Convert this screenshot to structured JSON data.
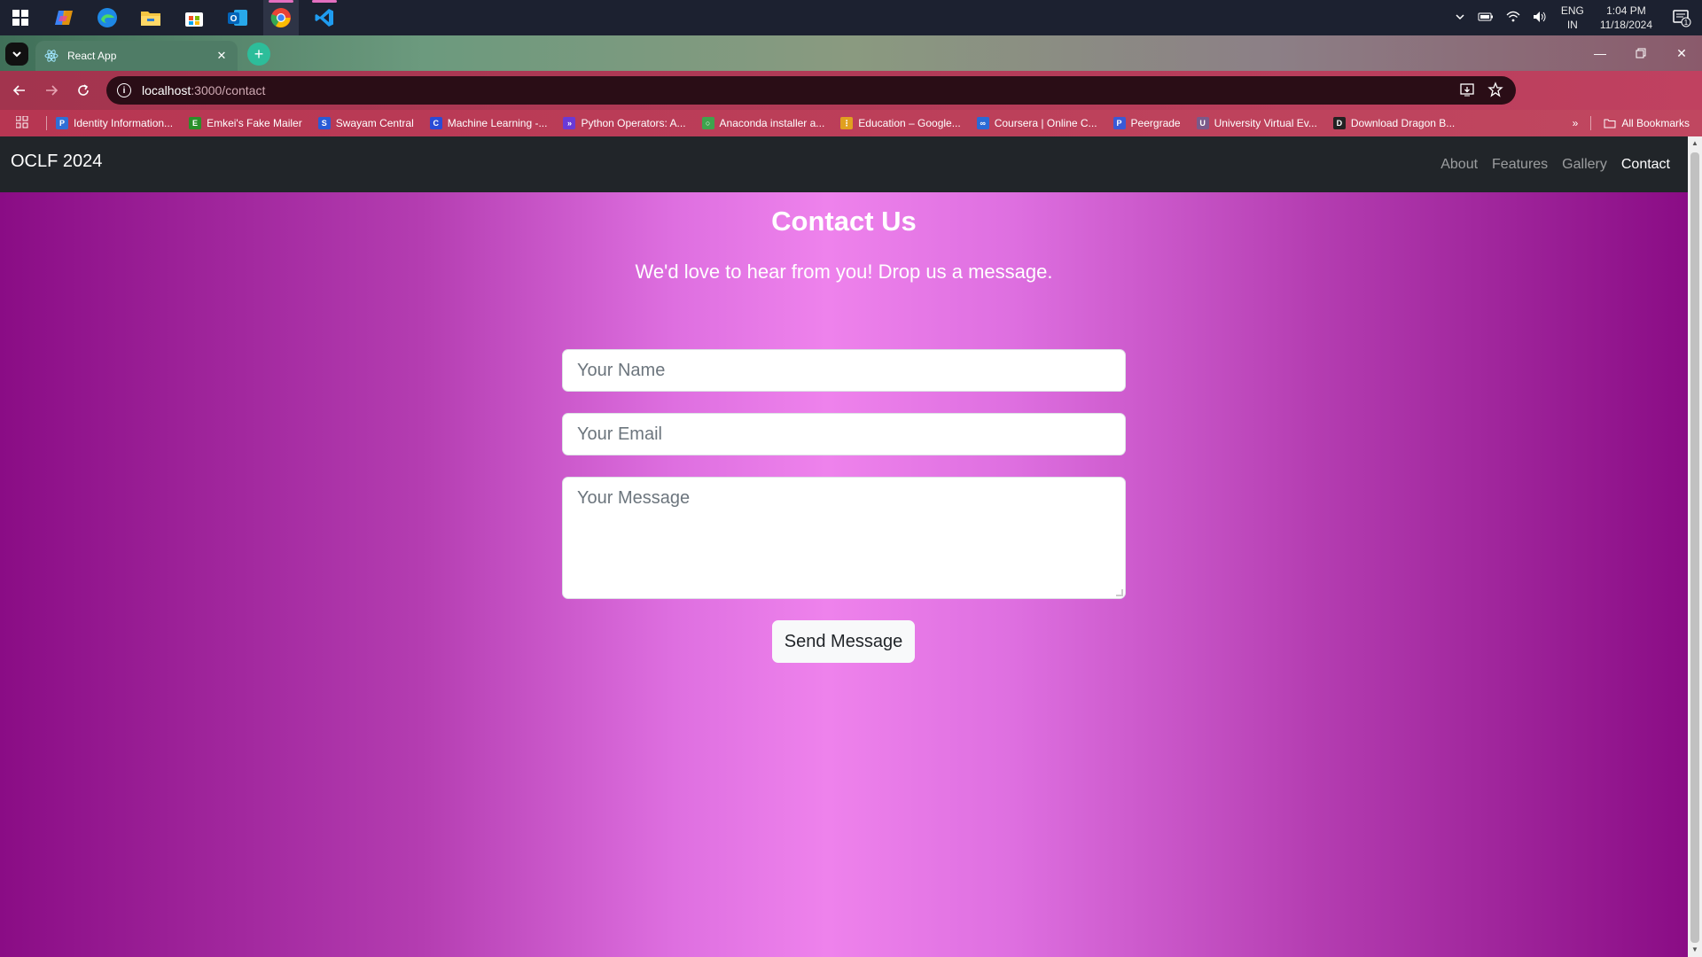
{
  "taskbar": {
    "apps": [
      "windows-start-icon",
      "copilot-icon",
      "edge-icon",
      "file-explorer-icon",
      "microsoft-store-icon",
      "outlook-icon",
      "chrome-icon",
      "vscode-icon"
    ],
    "language_line1": "ENG",
    "language_line2": "IN",
    "time": "1:04 PM",
    "date": "11/18/2024",
    "notification_count": "1"
  },
  "browser": {
    "tab_title": "React App",
    "url_host": "localhost",
    "url_path": ":3000/contact",
    "bookmarks": [
      {
        "label": "Identity Information...",
        "color": "#2f6fd6",
        "glyph": "P"
      },
      {
        "label": "Emkei's Fake Mailer",
        "color": "#2a8f2a",
        "glyph": "E"
      },
      {
        "label": "Swayam Central",
        "color": "#2a5bd6",
        "glyph": "S"
      },
      {
        "label": "Machine Learning -...",
        "color": "#2a4bd6",
        "glyph": "C"
      },
      {
        "label": "Python Operators: A...",
        "color": "#6a3ad6",
        "glyph": "»"
      },
      {
        "label": "Anaconda installer a...",
        "color": "#3fa34d",
        "glyph": "○"
      },
      {
        "label": "Education – Google...",
        "color": "#e0a020",
        "glyph": "⋮"
      },
      {
        "label": "Coursera | Online C...",
        "color": "#2a6ad6",
        "glyph": "∞"
      },
      {
        "label": "Peergrade",
        "color": "#3a5ad6",
        "glyph": "P"
      },
      {
        "label": "University Virtual Ev...",
        "color": "#7a5a8a",
        "glyph": "U"
      },
      {
        "label": "Download Dragon B...",
        "color": "#222222",
        "glyph": "D"
      }
    ],
    "all_bookmarks": "All Bookmarks"
  },
  "navbar": {
    "brand": "OCLF 2024",
    "links": [
      "About",
      "Features",
      "Gallery",
      "Contact"
    ],
    "active": "Contact"
  },
  "contact": {
    "heading": "Contact Us",
    "subheading": "We'd love to hear from you! Drop us a message.",
    "name_placeholder": "Your Name",
    "email_placeholder": "Your Email",
    "message_placeholder": "Your Message",
    "send_label": "Send Message"
  },
  "colors": {
    "navbar_bg": "#212529",
    "page_gradient_edge": "#8a0c85",
    "page_gradient_center": "#ee82ec"
  }
}
